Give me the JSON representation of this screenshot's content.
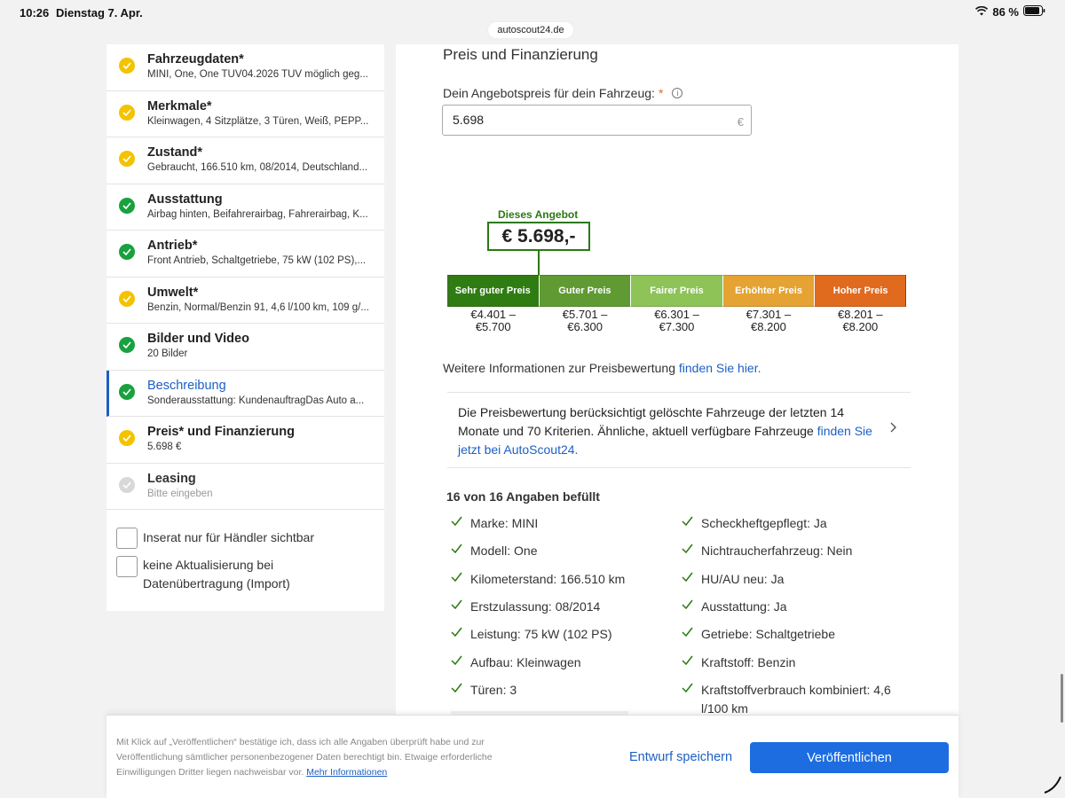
{
  "status_bar": {
    "time": "10:26",
    "date": "Dienstag 7. Apr.",
    "battery": "86 %",
    "url": "autoscout24.de"
  },
  "sidebar": {
    "items": [
      {
        "title": "Fahrzeugdaten*",
        "subtitle": "MINI, One, One TÜV04.2026 TÜV möglich geg...",
        "status": "yellow"
      },
      {
        "title": "Merkmale*",
        "subtitle": "Kleinwagen, 4 Sitzplätze, 3 Türen, Weiß, PEPP...",
        "status": "yellow"
      },
      {
        "title": "Zustand*",
        "subtitle": "Gebraucht, 166.510 km, 08/2014, Deutschland...",
        "status": "yellow"
      },
      {
        "title": "Ausstattung",
        "subtitle": "Airbag hinten, Beifahrerairbag, Fahrerairbag, K...",
        "status": "green"
      },
      {
        "title": "Antrieb*",
        "subtitle": "Front Antrieb, Schaltgetriebe, 75 kW (102 PS),...",
        "status": "green"
      },
      {
        "title": "Umwelt*",
        "subtitle": "Benzin, Normal/Benzin 91, 4,6 l/100 km, 109 g/...",
        "status": "yellow"
      },
      {
        "title": "Bilder und Video",
        "subtitle": "20 Bilder",
        "status": "green"
      },
      {
        "title": "Beschreibung",
        "subtitle": "Sonderausstattung: KundenauftragDas Auto a...",
        "status": "green"
      },
      {
        "title": "Preis* und Finanzierung",
        "subtitle": "5.698 €",
        "status": "yellow"
      },
      {
        "title": "Leasing",
        "subtitle": "Bitte eingeben",
        "status": "gray"
      }
    ],
    "checkbox_dealer": "Inserat nur für Händler sichtbar",
    "checkbox_no_update": "keine Aktualisierung bei Datenübertragung (Import)"
  },
  "main": {
    "section_title": "Preis und Finanzierung",
    "price_label": "Dein Angebotspreis für dein Fahrzeug:",
    "price_required": "*",
    "price_value": "5.698",
    "currency_symbol": "€",
    "offer_label": "Dieses Angebot",
    "offer_value": "€ 5.698,-",
    "ratings": [
      {
        "label": "Sehr guter Preis",
        "from": "€4.401 –",
        "to": "€5.700",
        "color": "#2f7c12"
      },
      {
        "label": "Guter Preis",
        "from": "€5.701 –",
        "to": "€6.300",
        "color": "#5f9a33"
      },
      {
        "label": "Fairer Preis",
        "from": "€6.301 –",
        "to": "€7.300",
        "color": "#8dc357"
      },
      {
        "label": "Erhöhter Preis",
        "from": "€7.301 –",
        "to": "€8.200",
        "color": "#e4a332"
      },
      {
        "label": "Hoher Preis",
        "from": "€8.201 –",
        "to": "€8.200",
        "color": "#e06a1e"
      }
    ],
    "more_info_text": "Weitere Informationen zur Preisbewertung ",
    "more_info_link": "finden Sie hier.",
    "notice_text": "Die Preisbewertung berücksichtigt gelöschte Fahrzeuge der letzten 14 Monate und 70 Kriterien. Ähnliche, aktuell verfügbare Fahrzeuge ",
    "notice_link": "finden Sie jetzt bei AutoScout24.",
    "filled_title": "16 von 16 Angaben befüllt",
    "facts_left": [
      "Marke: MINI",
      "Modell: One",
      "Kilometerstand: 166.510 km",
      "Erstzulassung: 08/2014",
      "Leistung: 75 kW (102 PS)",
      "Aufbau: Kleinwagen",
      "Türen: 3"
    ],
    "facts_right": [
      "Scheckheftgepflegt: Ja",
      "Nichtraucherfahrzeug: Nein",
      "HU/AU neu: Ja",
      "Ausstattung: Ja",
      "Getriebe: Schaltgetriebe",
      "Kraftstoff: Benzin",
      "Kraftstoffverbrauch kombiniert: 4,6 l/100 km"
    ]
  },
  "footer": {
    "legal_text": "Mit Klick auf „Veröffentlichen“ bestätige ich, dass ich alle Angaben überprüft habe und zur Veröffentlichung sämtlicher personenbezogener Daten berechtigt bin. Etwaige erforderliche Einwilligungen Dritter liegen nachweisbar vor. ",
    "legal_link": "Mehr Informationen",
    "draft_label": "Entwurf speichern",
    "publish_label": "Veröffentlichen"
  },
  "colors": {
    "accent": "#1d5fc4",
    "publish": "#1d6de0",
    "status_green": "#19a13f",
    "status_yellow": "#f3c300",
    "offer_green": "#2a7a12"
  }
}
